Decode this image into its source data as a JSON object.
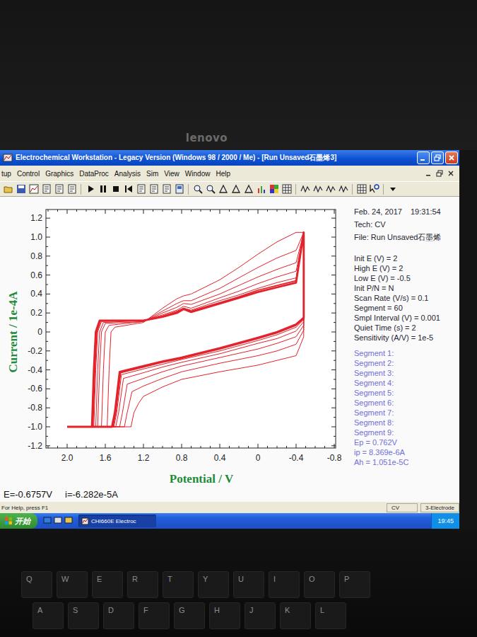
{
  "laptop": {
    "logo": "lenovo"
  },
  "window": {
    "title": "Electrochemical Workstation - Legacy Version (Windows 98 / 2000 / Me) - [Run Unsaved石墨烯3]"
  },
  "menu": [
    "tup",
    "Control",
    "Graphics",
    "DataProc",
    "Analysis",
    "Sim",
    "View",
    "Window",
    "Help"
  ],
  "chart": {
    "y_axis": {
      "title": "Current / 1e-4A",
      "ticks": [
        "1.2",
        "1.0",
        "0.8",
        "0.6",
        "0.4",
        "0.2",
        "0",
        "-0.2",
        "-0.4",
        "-0.6",
        "-0.8",
        "-1.0",
        "-1.2"
      ]
    },
    "x_axis": {
      "title": "Potential / V",
      "ticks": [
        "2.0",
        "1.6",
        "1.2",
        "0.8",
        "0.4",
        "0",
        "-0.4",
        "-0.8"
      ]
    },
    "cycles": [
      {
        "potential": [
          2.0,
          1.58,
          1.56,
          1.54,
          1.5,
          1.2,
          1.0,
          0.85,
          0.78,
          0.7,
          0.4,
          0.2,
          0,
          -0.2,
          -0.4,
          -0.48,
          -0.48,
          -0.4,
          -0.2,
          0,
          0.4,
          0.8,
          1.0,
          1.2,
          1.25,
          1.3,
          1.33,
          2.0
        ],
        "current": [
          -1.0,
          -1.0,
          -0.4,
          0.0,
          0.05,
          0.1,
          0.25,
          0.35,
          0.38,
          0.4,
          0.55,
          0.68,
          0.82,
          0.95,
          1.05,
          1.05,
          -0.05,
          -0.25,
          -0.3,
          -0.35,
          -0.42,
          -0.5,
          -0.58,
          -0.68,
          -0.75,
          -0.85,
          -1.0,
          -1.0
        ]
      },
      {
        "potential": [
          2.0,
          1.64,
          1.62,
          1.6,
          1.56,
          1.2,
          1.0,
          0.85,
          0.78,
          0.7,
          0.4,
          0.2,
          0,
          -0.2,
          -0.4,
          -0.48,
          -0.48,
          -0.4,
          -0.2,
          0,
          0.4,
          0.8,
          1.0,
          1.2,
          1.32,
          1.37,
          1.4,
          2.0
        ],
        "current": [
          -1.0,
          -1.0,
          -0.4,
          0.0,
          0.07,
          0.11,
          0.22,
          0.3,
          0.33,
          0.33,
          0.46,
          0.57,
          0.68,
          0.78,
          0.86,
          1.05,
          0.02,
          -0.13,
          -0.2,
          -0.25,
          -0.33,
          -0.42,
          -0.49,
          -0.57,
          -0.63,
          -0.85,
          -1.0,
          -1.0
        ]
      },
      {
        "potential": [
          2.0,
          1.68,
          1.66,
          1.64,
          1.6,
          1.2,
          1.0,
          0.85,
          0.78,
          0.7,
          0.4,
          0.2,
          0,
          -0.2,
          -0.4,
          -0.48,
          -0.48,
          -0.4,
          -0.2,
          0,
          0.4,
          0.8,
          1.0,
          1.2,
          1.37,
          1.42,
          1.45,
          2.0
        ],
        "current": [
          -1.0,
          -1.0,
          -0.4,
          0.0,
          0.09,
          0.11,
          0.2,
          0.26,
          0.3,
          0.29,
          0.4,
          0.49,
          0.58,
          0.66,
          0.73,
          1.05,
          0.07,
          -0.05,
          -0.12,
          -0.18,
          -0.27,
          -0.36,
          -0.42,
          -0.49,
          -0.55,
          -0.85,
          -1.0,
          -1.0
        ]
      },
      {
        "potential": [
          2.0,
          1.7,
          1.68,
          1.66,
          1.62,
          1.2,
          1.0,
          0.85,
          0.78,
          0.7,
          0.4,
          0.2,
          0,
          -0.2,
          -0.4,
          -0.48,
          -0.48,
          -0.4,
          -0.2,
          0,
          0.4,
          0.8,
          1.0,
          1.2,
          1.41,
          1.46,
          1.49,
          2.0
        ],
        "current": [
          -1.0,
          -1.0,
          -0.4,
          0.0,
          0.1,
          0.12,
          0.18,
          0.23,
          0.27,
          0.25,
          0.36,
          0.43,
          0.51,
          0.58,
          0.64,
          1.05,
          0.11,
          0.01,
          -0.07,
          -0.12,
          -0.23,
          -0.32,
          -0.37,
          -0.43,
          -0.49,
          -0.85,
          -1.0,
          -1.0
        ]
      },
      {
        "potential": [
          2.0,
          1.72,
          1.7,
          1.68,
          1.64,
          1.2,
          1.0,
          0.85,
          0.78,
          0.7,
          0.4,
          0.2,
          0,
          -0.2,
          -0.4,
          -0.48,
          -0.48,
          -0.4,
          -0.2,
          0,
          0.4,
          0.8,
          1.0,
          1.2,
          1.43,
          1.48,
          1.51,
          2.0
        ],
        "current": [
          -1.0,
          -1.0,
          -0.4,
          0.0,
          0.11,
          0.12,
          0.17,
          0.22,
          0.25,
          0.23,
          0.33,
          0.39,
          0.46,
          0.52,
          0.57,
          1.05,
          0.13,
          0.05,
          -0.03,
          -0.09,
          -0.2,
          -0.29,
          -0.34,
          -0.39,
          -0.45,
          -0.85,
          -1.0,
          -1.0
        ]
      },
      {
        "potential": [
          2.0,
          1.73,
          1.71,
          1.69,
          1.65,
          1.2,
          1.0,
          0.85,
          0.78,
          0.7,
          0.4,
          0.2,
          0,
          -0.2,
          -0.4,
          -0.48,
          -0.48,
          -0.4,
          -0.2,
          0,
          0.4,
          0.8,
          1.0,
          1.2,
          1.44,
          1.49,
          1.52,
          2.0
        ],
        "current": [
          -1.0,
          -1.0,
          -0.4,
          0.0,
          0.12,
          0.12,
          0.16,
          0.21,
          0.25,
          0.22,
          0.31,
          0.37,
          0.44,
          0.49,
          0.54,
          1.05,
          0.14,
          0.07,
          -0.01,
          -0.07,
          -0.18,
          -0.28,
          -0.32,
          -0.37,
          -0.43,
          -0.85,
          -1.0,
          -1.0
        ]
      },
      {
        "potential": [
          2.0,
          1.74,
          1.72,
          1.7,
          1.66,
          1.2,
          1.0,
          0.85,
          0.78,
          0.7,
          0.4,
          0.2,
          0,
          -0.2,
          -0.4,
          -0.48,
          -0.48,
          -0.4,
          -0.2,
          0,
          0.4,
          0.8,
          1.0,
          1.2,
          1.45,
          1.5,
          1.53,
          2.0
        ],
        "current": [
          -1.0,
          -1.0,
          -0.4,
          0.0,
          0.12,
          0.12,
          0.16,
          0.2,
          0.24,
          0.21,
          0.3,
          0.36,
          0.42,
          0.47,
          0.52,
          1.05,
          0.15,
          0.08,
          0.0,
          -0.06,
          -0.17,
          -0.27,
          -0.31,
          -0.36,
          -0.42,
          -0.85,
          -1.0,
          -1.0
        ]
      }
    ]
  },
  "info": {
    "date": "Feb. 24, 2017",
    "time": "19:31:54",
    "tech": "Tech: CV",
    "file": "File: Run Unsaved石墨烯",
    "parameters": [
      "Init E (V) = 2",
      "High E (V) = 2",
      "Low E (V) = -0.5",
      "Init P/N = N",
      "Scan Rate (V/s) = 0.1",
      "Segment = 60",
      "Smpl Interval (V) = 0.001",
      "Quiet Time (s) = 2",
      "Sensitivity (A/V) = 1e-5"
    ],
    "segments": [
      "Segment 1:",
      "Segment 2:",
      "Segment 3:",
      "Segment 4:",
      "Segment 5:",
      "Segment 6:",
      "Segment 7:",
      "Segment 8:",
      "Segment 9:"
    ],
    "results": [
      "Ep = 0.762V",
      "ip = 8.369e-6A",
      "Ah = 1.051e-5C"
    ]
  },
  "readout": {
    "potential": "E=-0.6757V",
    "current": "i=-6.282e-5A"
  },
  "status_bar": {
    "help": "For Help, press F1",
    "fields": [
      "CV",
      "3-Electrode"
    ]
  },
  "taskbar": {
    "start": "开始",
    "tasks": [
      {
        "label": "CHI660E Electroc",
        "selected": true
      }
    ],
    "clock": "19:45"
  },
  "keyboard": {
    "rows": [
      [
        "Q",
        "W",
        "E",
        "R",
        "T",
        "Y",
        "U",
        "I",
        "O",
        "P"
      ],
      [
        "A",
        "S",
        "D",
        "F",
        "G",
        "H",
        "J",
        "K",
        "L"
      ]
    ]
  }
}
